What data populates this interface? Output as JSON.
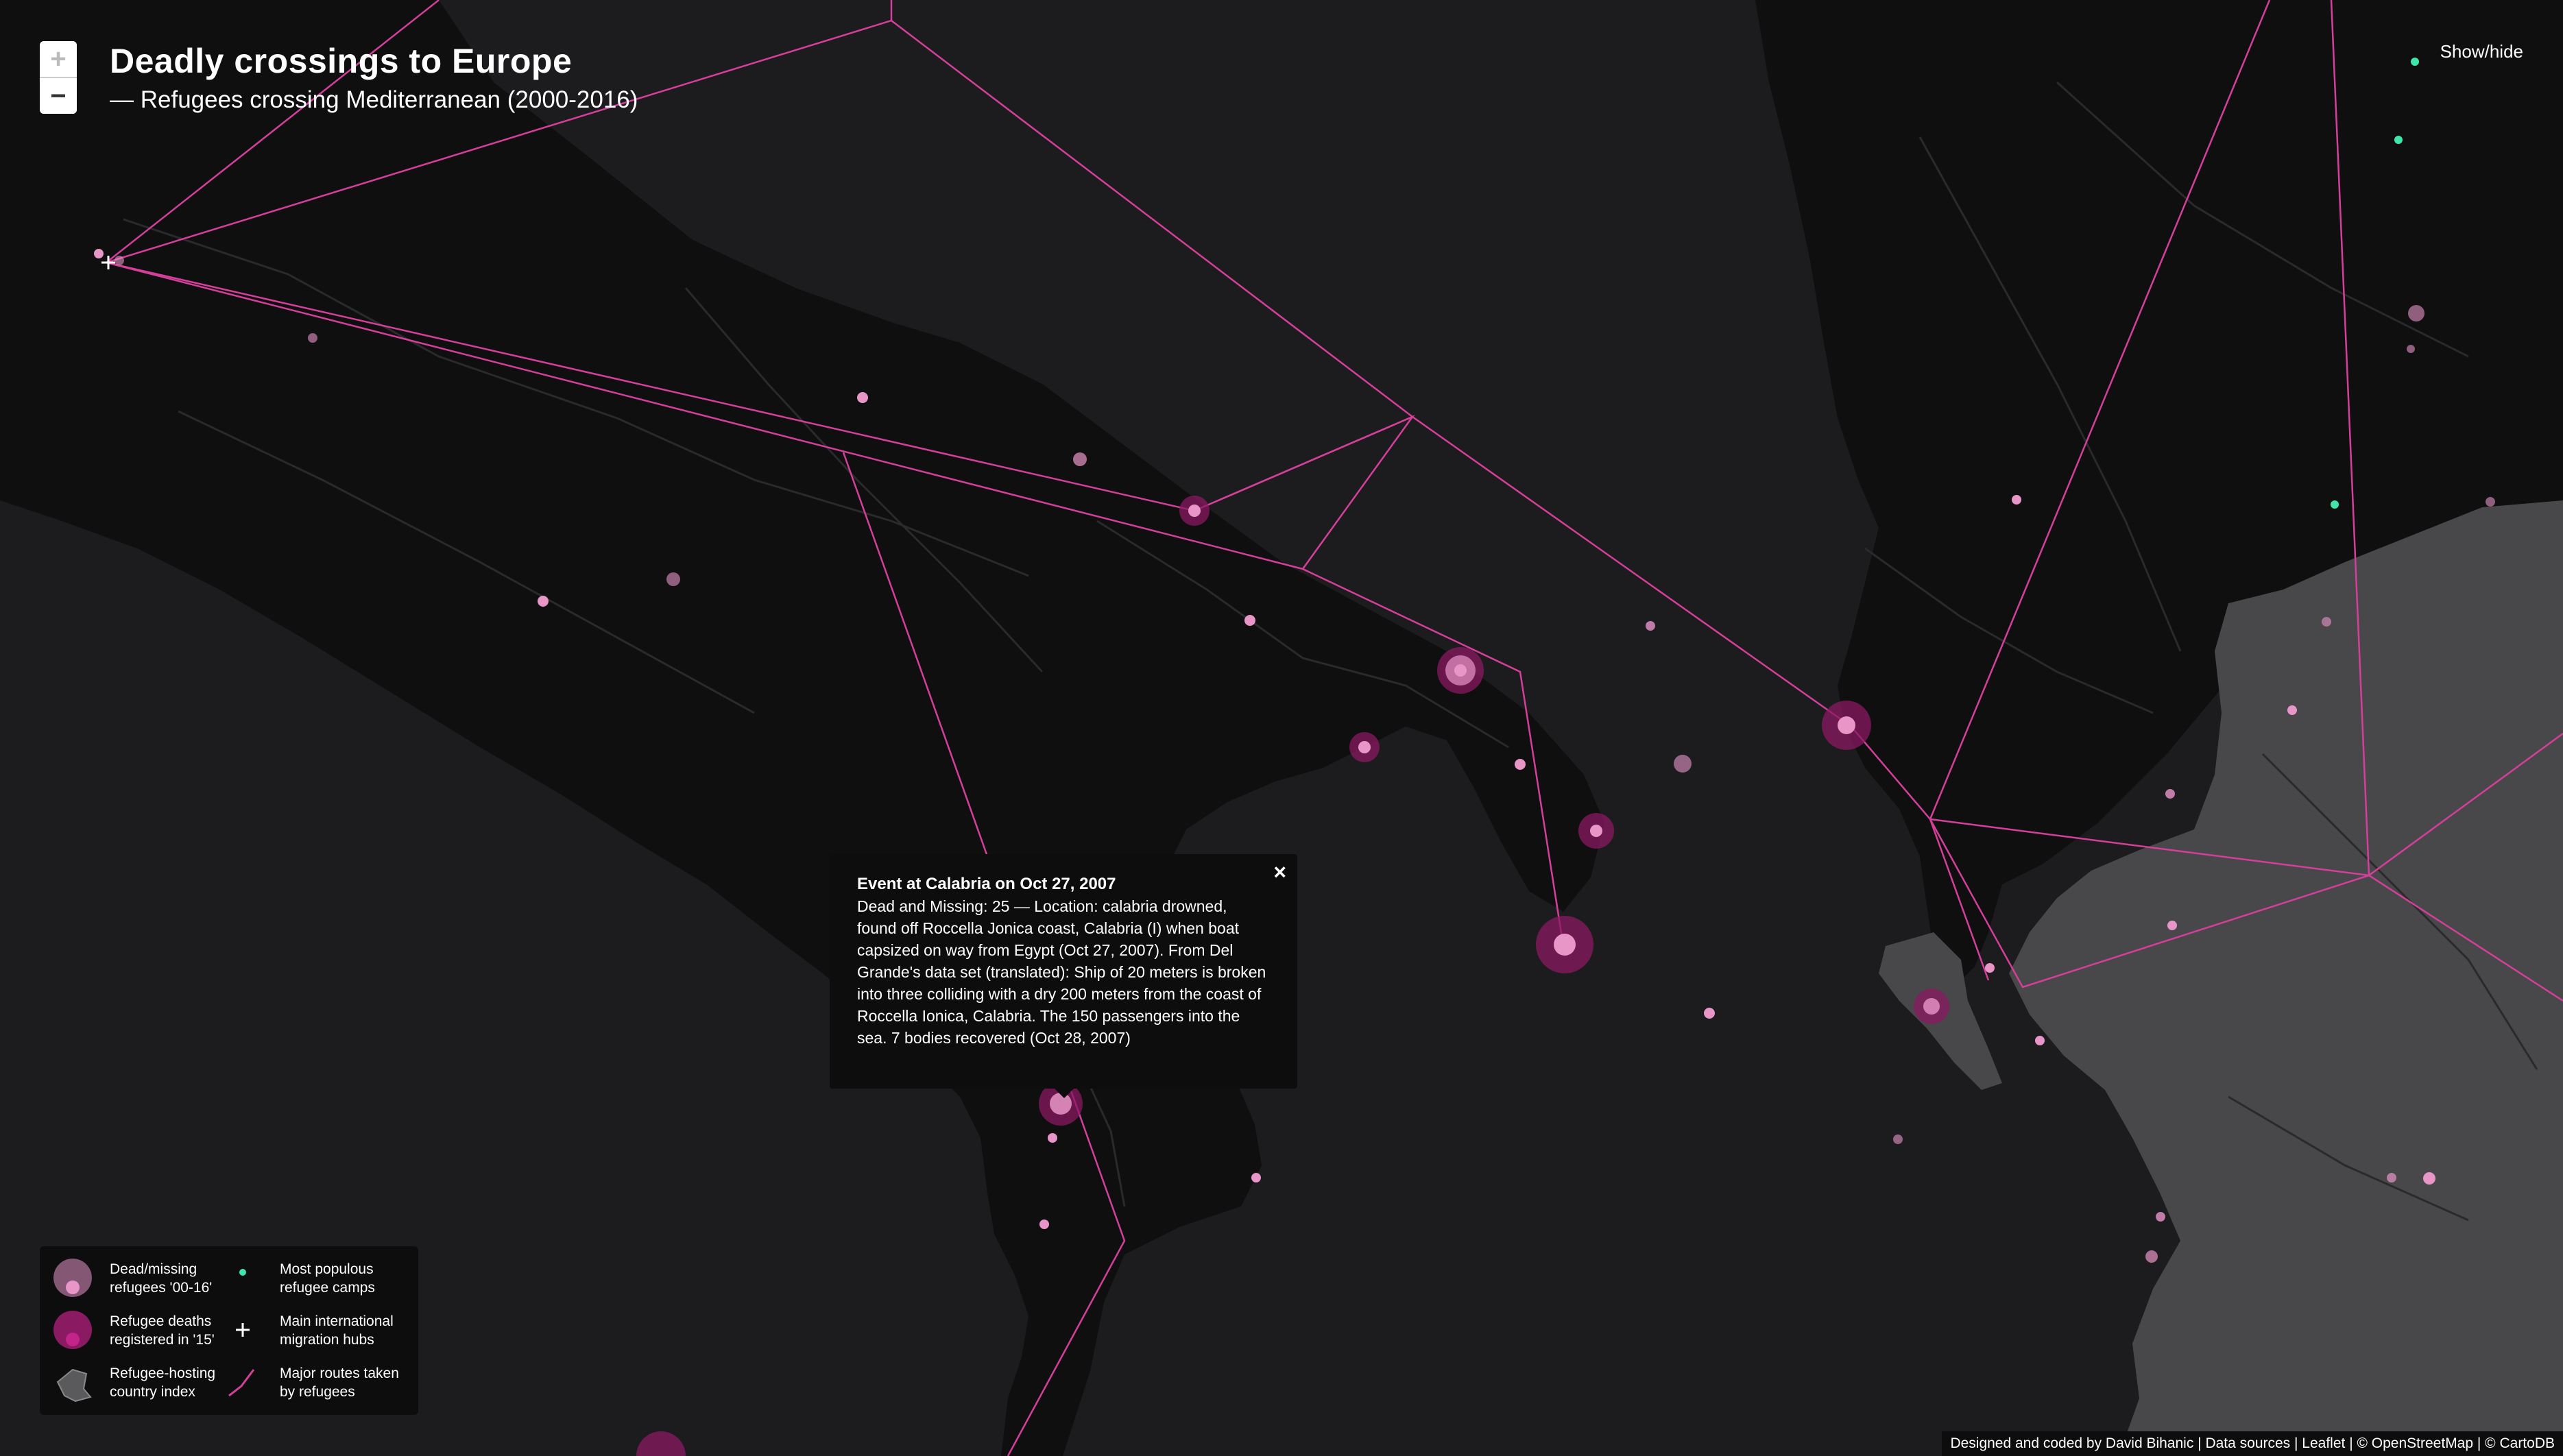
{
  "title": "Deadly crossings to Europe",
  "subtitle": "— Refugees crossing Mediterranean (2000-2016)",
  "controls": {
    "zoom_in": "+",
    "zoom_out": "−",
    "show_hide": "Show/hide"
  },
  "popup": {
    "title": "Event at Calabria on Oct 27, 2007",
    "body": "Dead and Missing: 25 — Location: calabria drowned, found off Roccella Jonica coast, Calabria (I) when boat capsized on way from Egypt (Oct 27, 2007). From Del Grande's data set (translated): Ship of 20 meters is broken into three colliding with a dry 200 meters from the coast of Roccella Ionica, Calabria. The 150 passengers into the sea. 7 bodies recovered (Oct 28, 2007)",
    "close": "×"
  },
  "legend": {
    "dead_missing": "Dead/missing refugees '00-16'",
    "refugee_deaths_2015": "Refugee deaths registered in '15'",
    "hosting_index": "Refugee-hosting country index",
    "populous_camps": "Most populous refugee camps",
    "migration_hubs": "Main international migration hubs",
    "major_routes": "Major routes taken by refugees"
  },
  "attribution": "Designed and coded by David Bihanic | Data sources | Leaflet | © OpenStreetMap | © CartoDB",
  "colors": {
    "background_sea": "#1c1c1e",
    "land": "#0f0f10",
    "hosting_country": "#4a4a4c",
    "route": "#d43f9a",
    "event": "#e895c8",
    "event_2015": "#8a1a62",
    "camp": "#3ee6a8",
    "text": "#ffffff"
  }
}
